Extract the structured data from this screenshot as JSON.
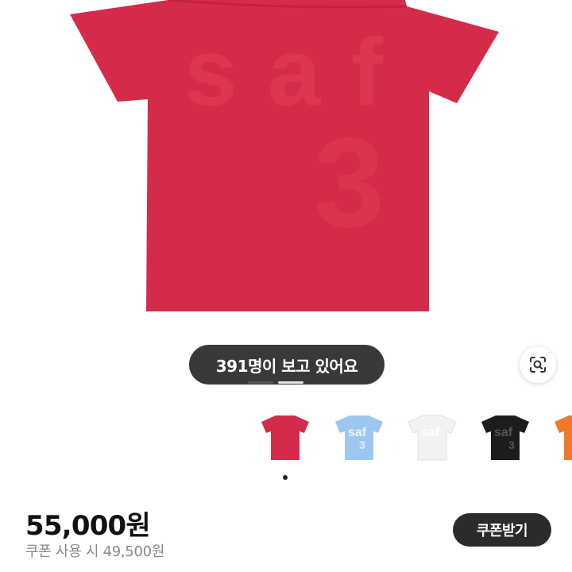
{
  "product": {
    "graphic_text": "saf",
    "graphic_number": "3",
    "shirt_color": "#d52b4a"
  },
  "viewers": {
    "text": "391명이 보고 있어요",
    "carousel_position": 0.5
  },
  "swatches": [
    {
      "name": "red",
      "color": "#d52b4a",
      "text": ""
    },
    {
      "name": "blue",
      "color": "#9cc7f0",
      "text": "saf"
    },
    {
      "name": "white",
      "color": "#f2f2f2",
      "text": "saf"
    },
    {
      "name": "black",
      "color": "#1c1c1c",
      "text": "saf"
    },
    {
      "name": "orange",
      "color": "#f0782a",
      "text": ""
    }
  ],
  "pricing": {
    "price": "55,000원",
    "coupon_price": "쿠폰 사용 시 49,500원",
    "coupon_button": "쿠폰받기"
  },
  "icons": {
    "lens": "image-search-icon"
  }
}
